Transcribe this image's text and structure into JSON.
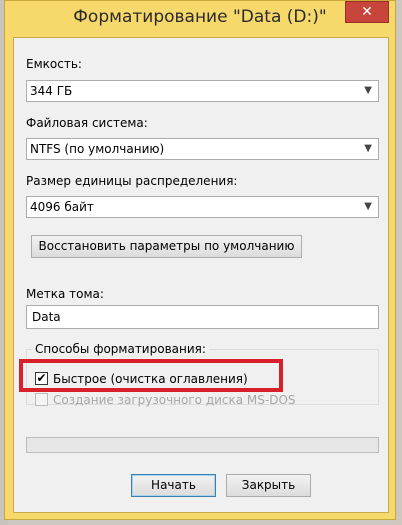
{
  "window": {
    "title": "Форматирование \"Data (D:)\"",
    "close_glyph": "✕"
  },
  "capacity": {
    "label": "Емкость:",
    "value": "344 ГБ"
  },
  "filesystem": {
    "label": "Файловая система:",
    "value": "NTFS (по умолчанию)"
  },
  "allocation": {
    "label": "Размер единицы распределения:",
    "value": "4096 байт"
  },
  "restore_defaults_button": "Восстановить параметры по умолчанию",
  "volume_label": {
    "label": "Метка тома:",
    "value": "Data"
  },
  "format_options": {
    "group_title": "Способы форматирования:",
    "quick_format": {
      "label": "Быстрое (очистка оглавления)",
      "checked": true,
      "mark": "✔"
    },
    "msdos_startup": {
      "label": "Создание загрузочного диска MS-DOS",
      "checked": false,
      "disabled": true
    }
  },
  "progress": {
    "value": 0
  },
  "buttons": {
    "start": "Начать",
    "close": "Закрыть"
  },
  "colors": {
    "titlebar": "#f7d86a",
    "close_button": "#c7453b",
    "highlight": "#d8202a",
    "dialog_background": "#f0f0f0"
  },
  "icons": {
    "dropdown": "chevron-down-icon",
    "close": "close-icon",
    "check": "checkmark-icon"
  }
}
